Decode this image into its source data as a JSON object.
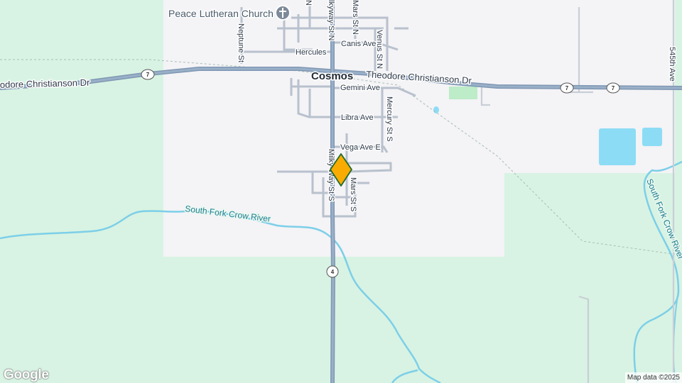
{
  "map": {
    "town_label": "Cosmos",
    "poi": {
      "name": "Peace Lutheran Church",
      "icon": "church-icon"
    },
    "highways": [
      {
        "name": "Theodore Christianson Dr",
        "route": "7"
      },
      {
        "name": "Milky Way St",
        "route": "4"
      }
    ],
    "labels": {
      "theodore_west": "odore Christianson Dr",
      "theodore_east": "Theodore Christianson Dr",
      "milky_way_n": "lkyway St N",
      "milky_way_s": "Milky Way St S",
      "neptune": "Neptune St",
      "mars_n": "Mars St N",
      "venus_n": "Venus St N",
      "canis": "Canis Ave",
      "hercules": "Hercules",
      "gemini": "Gemini Ave",
      "libra": "Libra Ave",
      "mercury_s": "Mercury St S",
      "vega": "Vega Ave E",
      "mars_s": "Mars St S",
      "ave_545": "545th Ave",
      "river_west": "South Fork Crow River",
      "river_east": "South Fork Crow River",
      "n_fragment": "N"
    },
    "route_shields": {
      "west": "7",
      "east_a": "7",
      "east_b": "7",
      "south": "4"
    },
    "marker": {
      "type": "location-pin",
      "color": "#f9ab00",
      "outline": "#1e6b2d"
    },
    "colors": {
      "land": "#d8f3e3",
      "urban": "#f4f3f6",
      "water": "#8ddcf5",
      "river": "#7ccfe8",
      "park": "#bcecc8",
      "highway": "#8aa0b9",
      "road": "#c9ced6"
    }
  },
  "branding": {
    "logo": "Google",
    "attribution": "Map data ©2025"
  }
}
